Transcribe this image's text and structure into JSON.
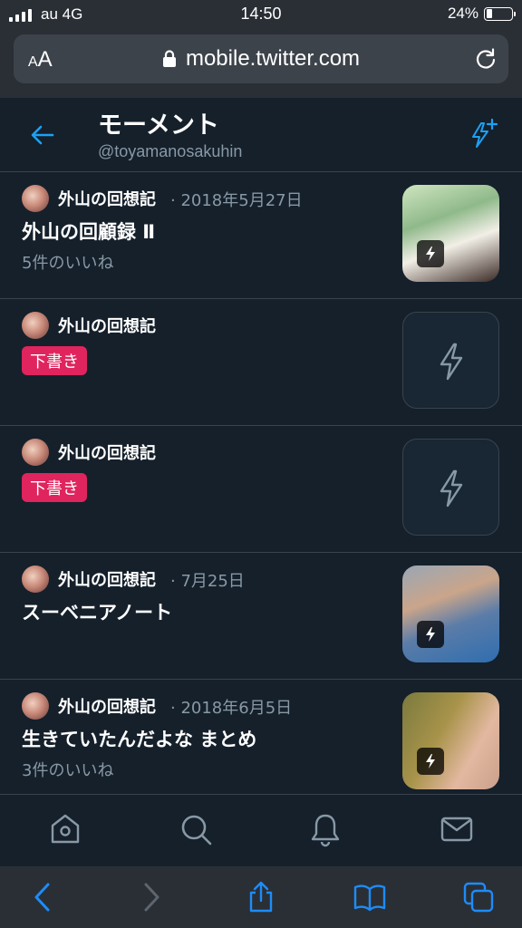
{
  "status": {
    "carrier": "au 4G",
    "time": "14:50",
    "battery_pct": "24%",
    "battery_level": 0.24
  },
  "browser": {
    "aa_label_small": "A",
    "aa_label_big": "A",
    "url": "mobile.twitter.com"
  },
  "header": {
    "title": "モーメント",
    "subtitle": "@toyamanosakuhin"
  },
  "moments": [
    {
      "author": "外山の回想記",
      "date": "· 2018年5月27日",
      "title": "外山の回顧録 Ⅱ",
      "likes": "5件のいいね",
      "draft": "",
      "thumb": "photo1"
    },
    {
      "author": "外山の回想記",
      "date": "",
      "title": "",
      "likes": "",
      "draft": "下書き",
      "thumb": "empty"
    },
    {
      "author": "外山の回想記",
      "date": "",
      "title": "",
      "likes": "",
      "draft": "下書き",
      "thumb": "empty"
    },
    {
      "author": "外山の回想記",
      "date": "· 7月25日",
      "title": "スーベニアノート",
      "likes": "",
      "draft": "",
      "thumb": "photo2"
    },
    {
      "author": "外山の回想記",
      "date": "· 2018年6月5日",
      "title": "生きていたんだよな まとめ",
      "likes": "3件のいいね",
      "draft": "",
      "thumb": "photo3"
    }
  ],
  "tabs": [
    "home-icon",
    "search-icon",
    "bell-icon",
    "mail-icon"
  ],
  "safari": [
    "back-icon",
    "forward-icon",
    "share-icon",
    "bookmarks-icon",
    "tabs-icon"
  ],
  "colors": {
    "accent": "#1da1f2",
    "draft": "#e0245e",
    "background": "#15202b"
  }
}
